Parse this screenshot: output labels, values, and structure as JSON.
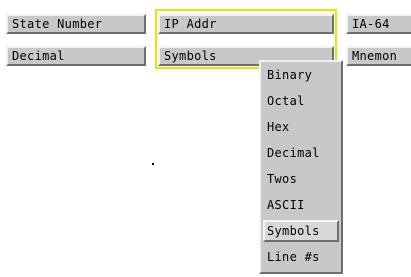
{
  "columns": {
    "state_number": {
      "label": "State Number",
      "format": "Decimal"
    },
    "ip_addr": {
      "label": "IP Addr",
      "format": "Symbols"
    },
    "ia64": {
      "label": "IA-64",
      "format": "Mnemon"
    }
  },
  "format_menu": {
    "items": [
      "Binary",
      "Octal",
      "Hex",
      "Decimal",
      "Twos",
      "ASCII",
      "Symbols",
      "Line #s"
    ],
    "active": "Symbols"
  },
  "colors": {
    "button_face": "#c8c8c8",
    "selection_outline": "#e6e600",
    "background": "#ffffff"
  }
}
